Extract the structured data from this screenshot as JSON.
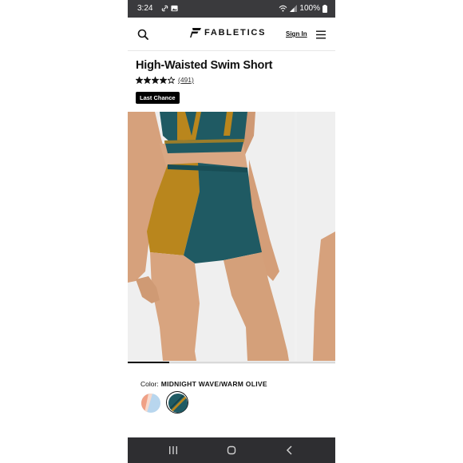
{
  "status_bar": {
    "time": "3:24",
    "battery": "100%"
  },
  "header": {
    "brand": "FABLETICS",
    "sign_in": "Sign In",
    "icons": [
      "search-icon",
      "brand-logo-icon",
      "menu-icon"
    ]
  },
  "product": {
    "title": "High-Waisted Swim Short",
    "rating": 4,
    "rating_max": 5,
    "review_count": "(491)",
    "badge": "Last Chance"
  },
  "gallery": {
    "progress_fraction": 0.2
  },
  "color": {
    "label": "Color:",
    "selected": "MIDNIGHT WAVE/WARM OLIVE",
    "swatches": [
      "coral-blue",
      "midnight-wave-warm-olive"
    ]
  },
  "colors": {
    "teal": "#1f5a63",
    "olive": "#b9861d",
    "skin": "#d9a783",
    "status_bar_bg": "#3a3a3d",
    "nav_bar_bg": "#2e2e31"
  },
  "nav_bar": {
    "icons": [
      "recent-apps-icon",
      "home-icon",
      "back-icon"
    ]
  }
}
